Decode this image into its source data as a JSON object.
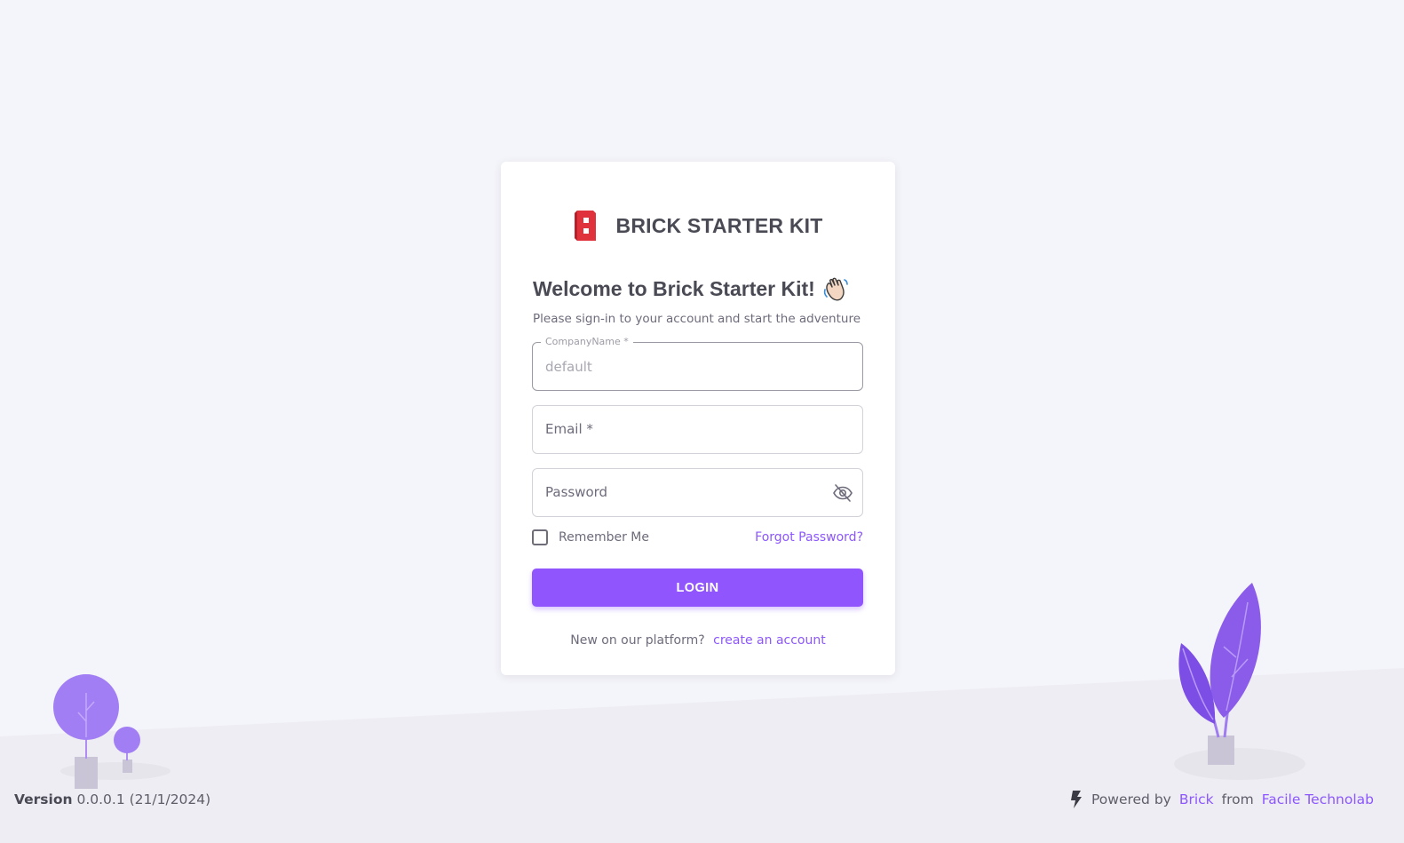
{
  "brand": {
    "name": "BRICK STARTER KIT",
    "logo_icon": "brick-logo-icon"
  },
  "welcome": {
    "title": "Welcome to Brick Starter Kit!",
    "icon": "waving-hand-icon"
  },
  "subtitle": "Please sign-in to your account and start the adventure",
  "form": {
    "company": {
      "label": "CompanyName *",
      "placeholder": "default",
      "value": ""
    },
    "email": {
      "label": "Email *",
      "value": ""
    },
    "password": {
      "label": "Password",
      "value": "",
      "toggle_icon": "eye-off-icon"
    },
    "remember_label": "Remember Me",
    "remember_checked": false,
    "forgot_label": "Forgot Password?",
    "login_label": "LOGIN"
  },
  "signup": {
    "text": "New on our platform?",
    "link": "create an account"
  },
  "footer": {
    "version_label": "Version",
    "version_value": "0.0.0.1 (21/1/2024)",
    "powered_text": "Powered by",
    "powered_brand": "Brick",
    "from_text": "from",
    "company": "Facile Technolab",
    "icon": "bolt-icon"
  },
  "colors": {
    "accent": "#9055fd",
    "link": "#8c57ff",
    "background": "#f4f5fa",
    "card": "#ffffff"
  }
}
